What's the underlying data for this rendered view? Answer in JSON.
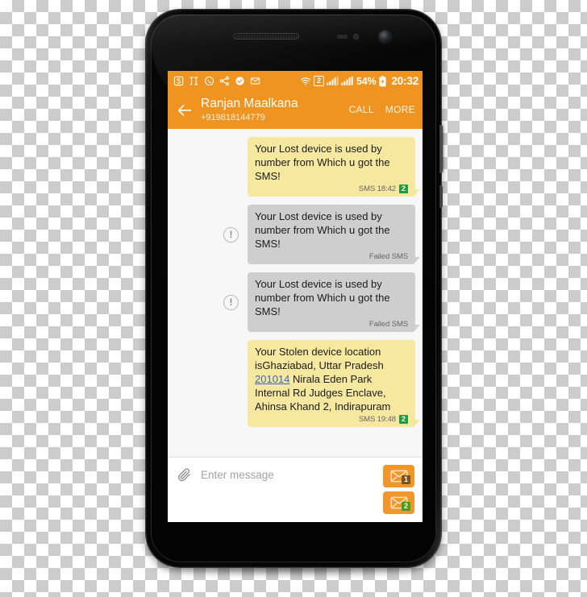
{
  "device": {
    "hardware": {
      "earpiece": "earpiece-speaker",
      "proximity_sensor": "proximity-sensor",
      "light_sensor": "light-sensor",
      "front_camera": "front-camera",
      "power_button": "power-button",
      "volume_button": "volume-button"
    }
  },
  "status_bar": {
    "left_icons": [
      {
        "name": "app-s-icon",
        "glyph": "S"
      },
      {
        "name": "app-et-icon",
        "glyph": "ET"
      },
      {
        "name": "whatsapp-icon",
        "glyph": "whatsapp"
      },
      {
        "name": "share-icon",
        "glyph": "share"
      },
      {
        "name": "check-circle-icon",
        "glyph": "check"
      },
      {
        "name": "envelope-icon",
        "glyph": "envelope"
      }
    ],
    "wifi_icon": "wifi-icon",
    "sim_indicator": "2",
    "signal_bars_1": "signal-bars-sim1-icon",
    "signal_bars_2": "signal-bars-sim2-icon",
    "battery_percent": "54%",
    "battery_icon": "battery-charging-icon",
    "time": "20:32"
  },
  "header": {
    "back_icon": "back-arrow-icon",
    "contact_name": "Ranjan Maalkana",
    "contact_number": "+919818144779",
    "actions": [
      {
        "name": "call-button",
        "label": "CALL"
      },
      {
        "name": "more-button",
        "label": "MORE"
      }
    ]
  },
  "messages": [
    {
      "id": "msg-1",
      "type": "sent",
      "failed": false,
      "text": "Your Lost device is used by number from Which u got the SMS!",
      "meta": "SMS 18:42",
      "sim": "2"
    },
    {
      "id": "msg-2",
      "type": "sent",
      "failed": true,
      "fail_icon": "failed-exclamation-icon",
      "text": "Your Lost device is used by number from Which u got the SMS!",
      "meta": "Failed SMS",
      "sim": ""
    },
    {
      "id": "msg-3",
      "type": "sent",
      "failed": true,
      "fail_icon": "failed-exclamation-icon",
      "text": "Your Lost device is used by number from Which u got the SMS!",
      "meta": "Failed SMS",
      "sim": ""
    },
    {
      "id": "msg-4",
      "type": "sent",
      "failed": false,
      "text_before_link": "Your Stolen device location isGhaziabad, Uttar Pradesh ",
      "link_text": "201014",
      "text_after_link": " Nirala Eden Park Internal Rd Judges Enclave, Ahinsa Khand 2, Indirapuram",
      "meta": "SMS 19:48",
      "sim": "2"
    }
  ],
  "composer": {
    "attach_icon": "paperclip-icon",
    "placeholder": "Enter message",
    "input_value": "",
    "send_buttons": [
      {
        "name": "send-sim1-button",
        "icon": "send-envelope-icon",
        "sim": "1"
      },
      {
        "name": "send-sim2-button",
        "icon": "send-envelope-icon",
        "sim": "2"
      }
    ]
  },
  "colors": {
    "accent_orange": "#ef9421",
    "sent_bubble": "#f6e89f",
    "failed_bubble": "#cecece",
    "sim_green": "#1f9c3d",
    "link_blue": "#3f63c4"
  }
}
